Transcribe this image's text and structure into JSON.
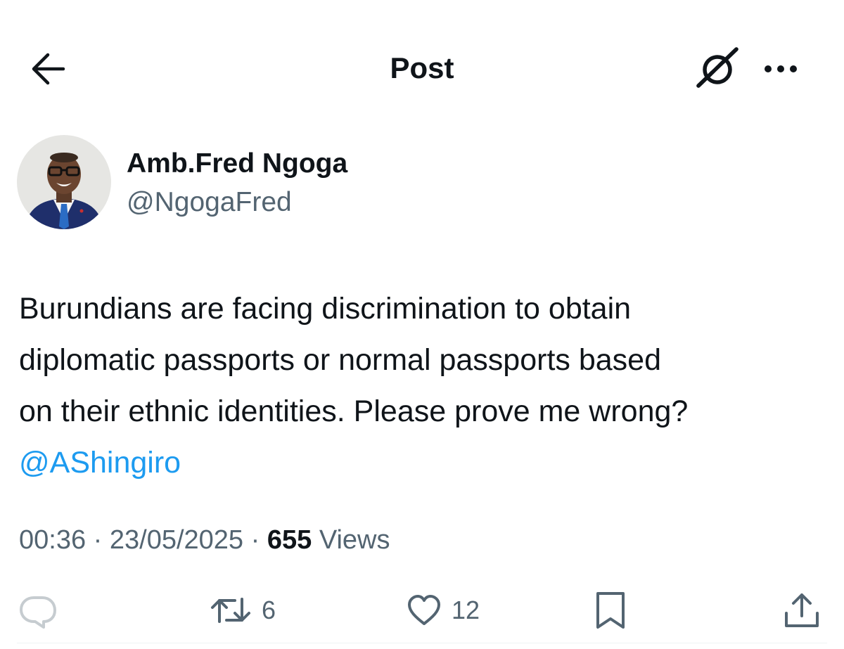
{
  "header": {
    "title": "Post",
    "icons": {
      "back": "arrow-left-icon",
      "grok": "grok-icon",
      "more": "more-horizontal-icon"
    }
  },
  "author": {
    "display_name": "Amb.Fred Ngoga",
    "handle": "@NgogaFred",
    "avatar": "profile-photo"
  },
  "tweet": {
    "lines": [
      "Burundians are facing discrimination to obtain",
      "diplomatic passports or normal passports based",
      "on their ethnic identities. Please prove me wrong?"
    ],
    "mention": "@AShingiro"
  },
  "meta": {
    "time": "00:36",
    "separator": "·",
    "date": "23/05/2025",
    "views_count": "655",
    "views_label": "Views"
  },
  "actions": {
    "reply": {
      "icon": "reply-icon",
      "count": ""
    },
    "repost": {
      "icon": "repost-icon",
      "count": "6"
    },
    "like": {
      "icon": "heart-icon",
      "count": "12"
    },
    "bookmark": {
      "icon": "bookmark-icon",
      "count": ""
    },
    "share": {
      "icon": "share-icon",
      "count": ""
    }
  },
  "colors": {
    "text": "#0f1419",
    "secondary": "#536471",
    "link": "#1d9bf0",
    "reply_icon": "#c6ccd0",
    "divider": "#eff3f4"
  }
}
